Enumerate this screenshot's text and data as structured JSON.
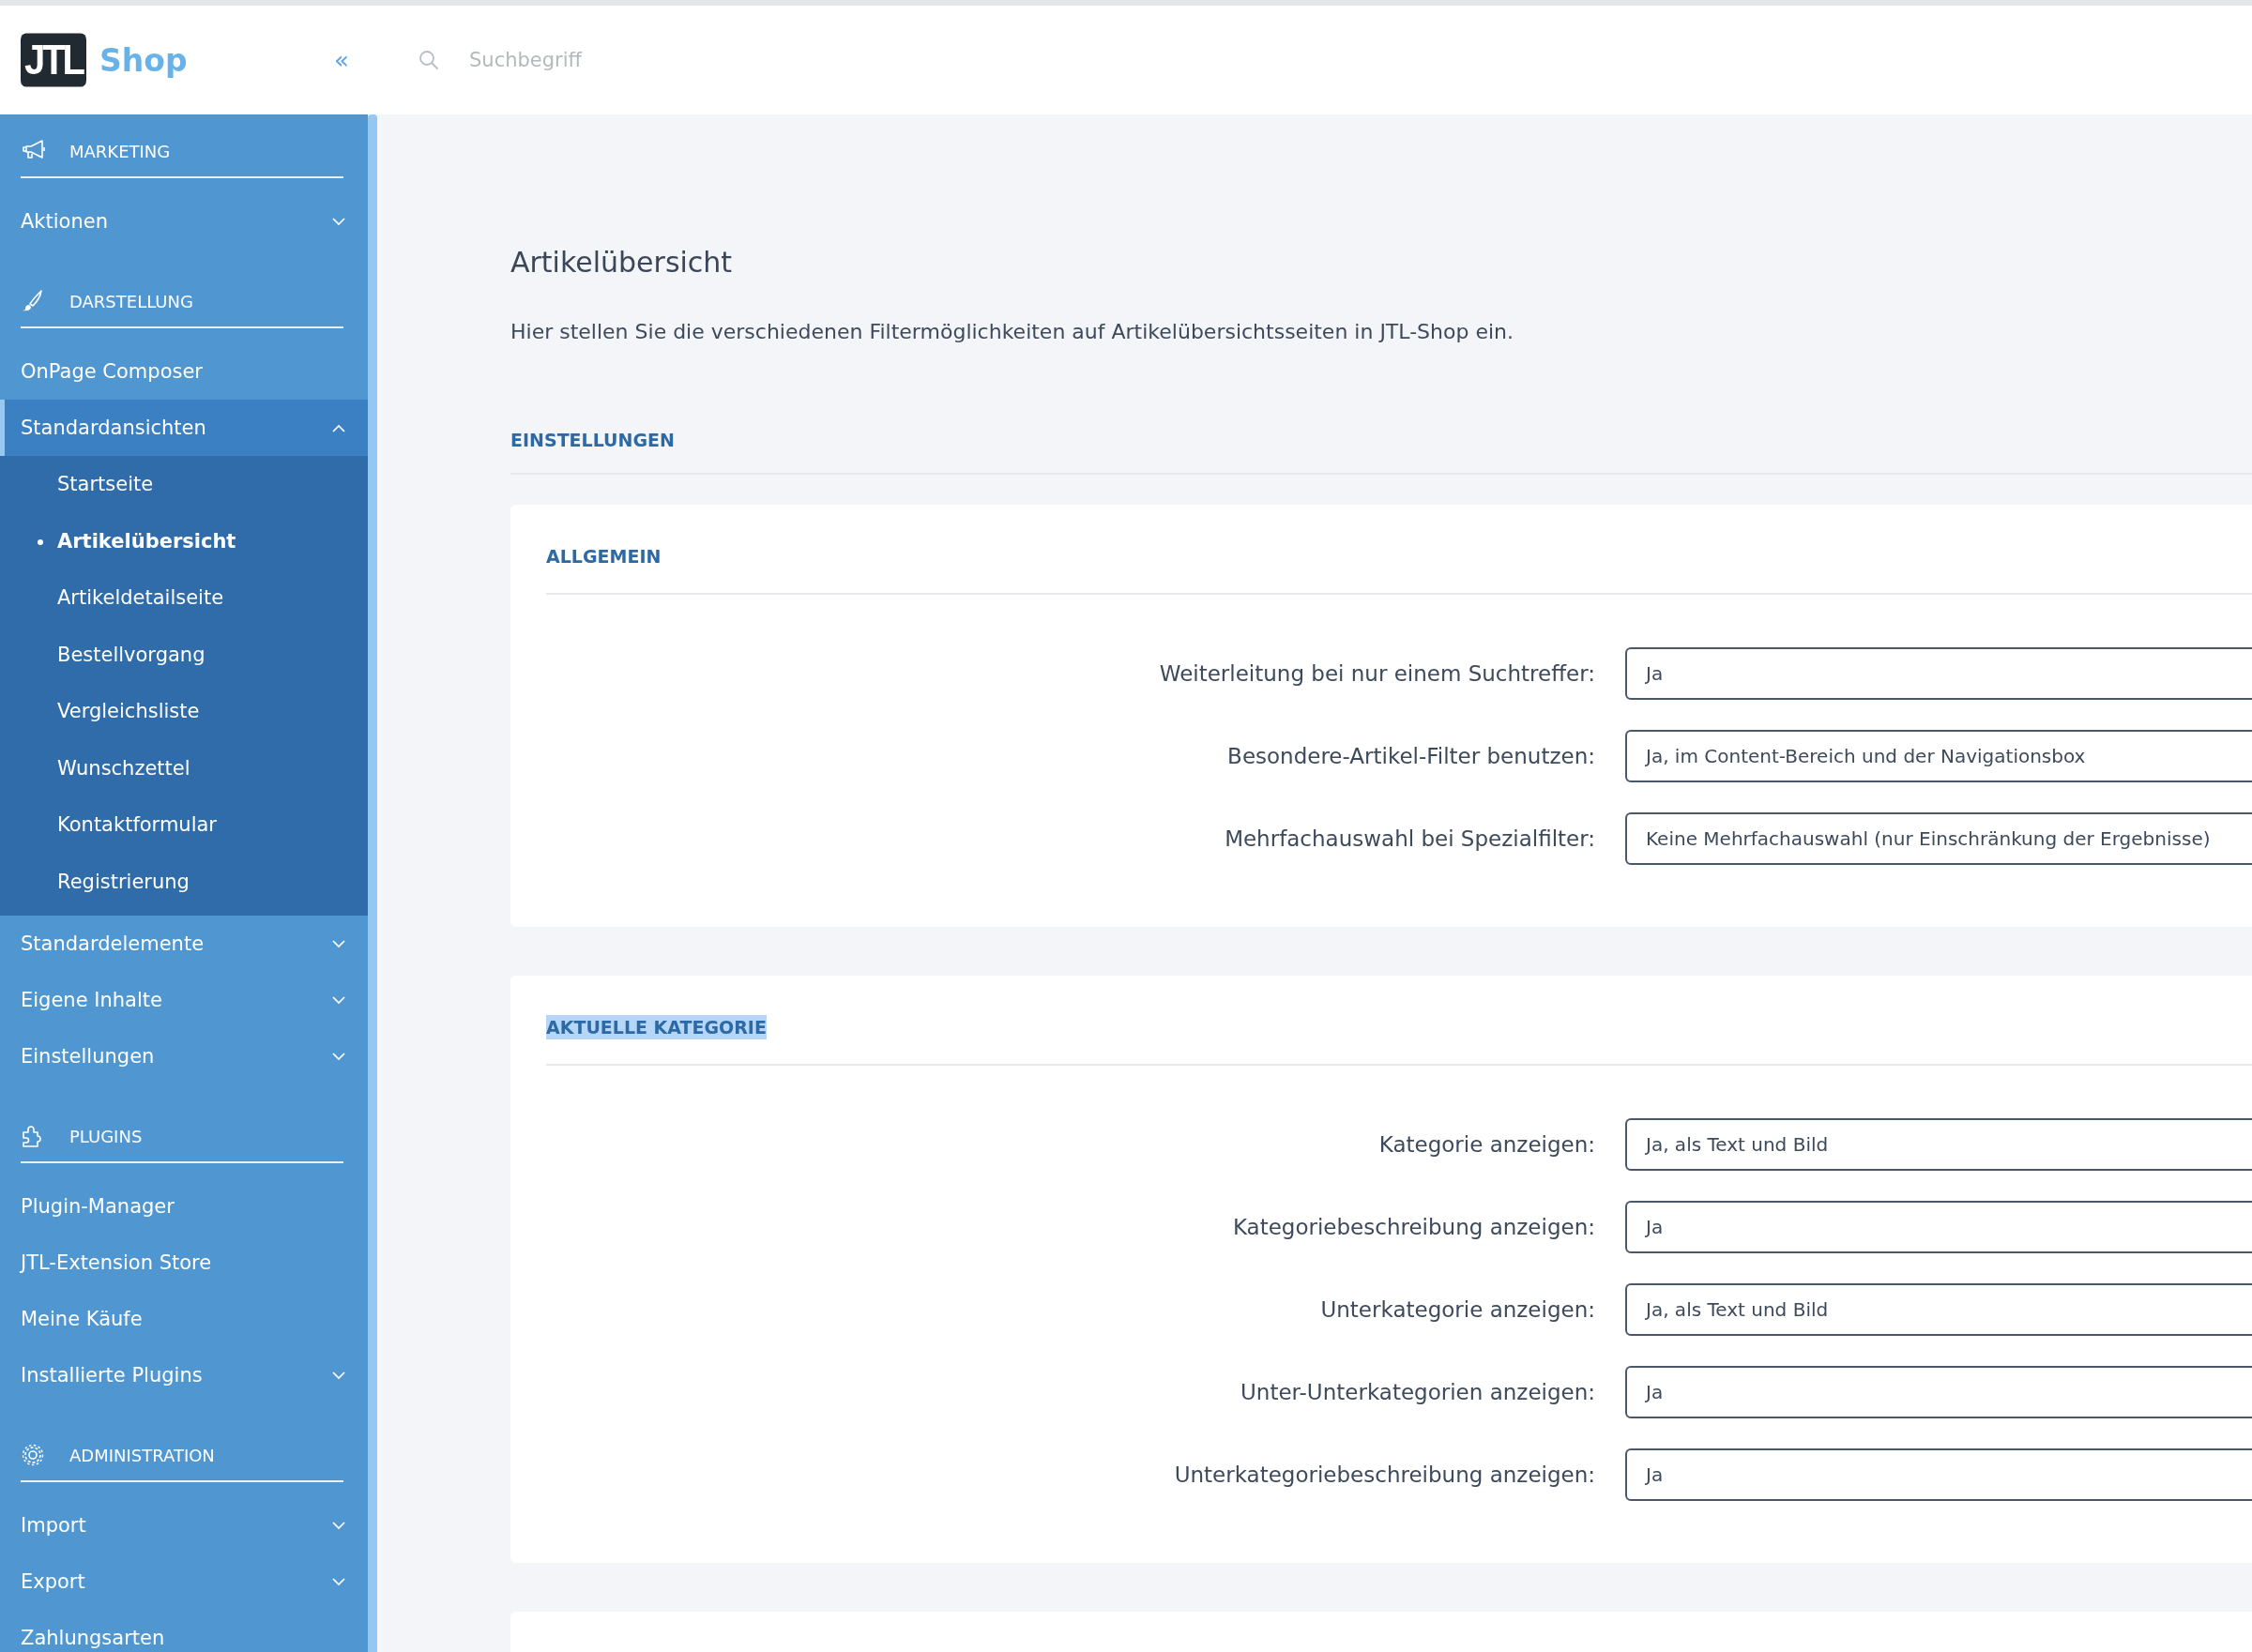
{
  "header": {
    "logo_mark": "JTL",
    "logo_text": "Shop",
    "collapse_toggle": "«",
    "search": {
      "placeholder": "Suchbegriff"
    }
  },
  "sidebar": {
    "sections": [
      {
        "title": "MARKETING",
        "items": [
          {
            "label": "Aktionen",
            "selected": false,
            "expanded": false
          }
        ]
      },
      {
        "title": "DARSTELLUNG",
        "items": [
          {
            "label": "OnPage Composer",
            "selected": false
          },
          {
            "label": "Standardansichten",
            "selected": true,
            "expanded": true,
            "children": [
              {
                "label": "Startseite",
                "selected": false
              },
              {
                "label": "Artikelübersicht",
                "selected": true
              },
              {
                "label": "Artikeldetailseite",
                "selected": false
              },
              {
                "label": "Bestellvorgang",
                "selected": false
              },
              {
                "label": "Vergleichsliste",
                "selected": false
              },
              {
                "label": "Wunschzettel",
                "selected": false
              },
              {
                "label": "Kontaktformular",
                "selected": false
              },
              {
                "label": "Registrierung",
                "selected": false
              }
            ]
          },
          {
            "label": "Standardelemente",
            "selected": false,
            "expanded": false
          },
          {
            "label": "Eigene Inhalte",
            "selected": false,
            "expanded": false
          },
          {
            "label": "Einstellungen",
            "selected": false,
            "expanded": false
          }
        ]
      },
      {
        "title": "PLUGINS",
        "items": [
          {
            "label": "Plugin-Manager",
            "selected": false
          },
          {
            "label": "JTL-Extension Store",
            "selected": false
          },
          {
            "label": "Meine Käufe",
            "selected": false
          },
          {
            "label": "Installierte Plugins",
            "selected": false,
            "expanded": false
          }
        ]
      },
      {
        "title": "ADMINISTRATION",
        "items": [
          {
            "label": "Import",
            "selected": false,
            "expanded": false
          },
          {
            "label": "Export",
            "selected": false,
            "expanded": false
          },
          {
            "label": "Zahlungsarten",
            "selected": false
          }
        ]
      }
    ]
  },
  "page": {
    "title": "Artikelübersicht",
    "description": "Hier stellen Sie die verschiedenen Filtermöglichkeiten auf Artikelübersichtsseiten in JTL-Shop ein.",
    "section_heading": "EINSTELLUNGEN",
    "cards": [
      {
        "heading": "ALLGEMEIN",
        "highlighted": false,
        "fields": [
          {
            "label": "Weiterleitung bei nur einem Suchtreffer:",
            "value": "Ja"
          },
          {
            "label": "Besondere-Artikel-Filter benutzen:",
            "value": "Ja, im Content-Bereich und der Navigationsbox"
          },
          {
            "label": "Mehrfachauswahl bei Spezialfilter:",
            "value": "Keine Mehrfachauswahl (nur Einschränkung der Ergebnisse)"
          }
        ]
      },
      {
        "heading": "AKTUELLE KATEGORIE",
        "highlighted": true,
        "fields": [
          {
            "label": "Kategorie anzeigen:",
            "value": "Ja, als Text und Bild"
          },
          {
            "label": "Kategoriebeschreibung anzeigen:",
            "value": "Ja"
          },
          {
            "label": "Unterkategorie anzeigen:",
            "value": "Ja, als Text und Bild"
          },
          {
            "label": "Unter-Unterkategorien anzeigen:",
            "value": "Ja"
          },
          {
            "label": "Unterkategoriebeschreibung anzeigen:",
            "value": "Ja"
          }
        ]
      }
    ],
    "next_card_peek": true
  }
}
